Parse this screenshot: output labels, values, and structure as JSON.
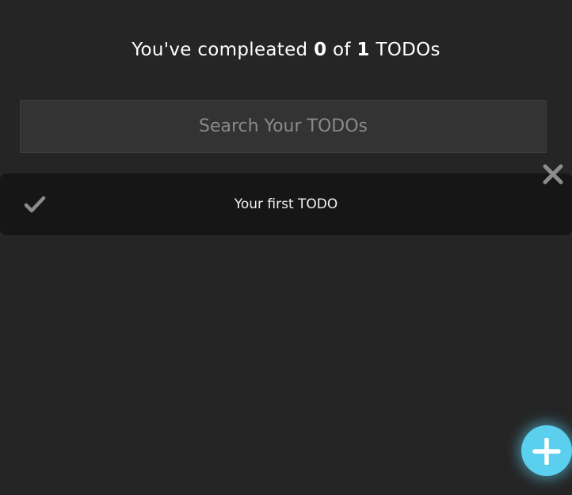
{
  "counter": {
    "prefix": "You've compleated",
    "completed": "0",
    "middle": "of",
    "total": "1",
    "suffix": "TODOs"
  },
  "search": {
    "placeholder": "Search Your TODOs",
    "value": ""
  },
  "todos": [
    {
      "text": "Your first TODO",
      "completed": false,
      "check_icon": "check-icon",
      "delete_icon": "close-icon"
    }
  ],
  "add_button": {
    "icon": "plus-icon"
  },
  "colors": {
    "background": "#252525",
    "item_background": "#161616",
    "search_background": "#333333",
    "accent": "#5bd0ee",
    "icon_gray": "#8c8c8c"
  }
}
